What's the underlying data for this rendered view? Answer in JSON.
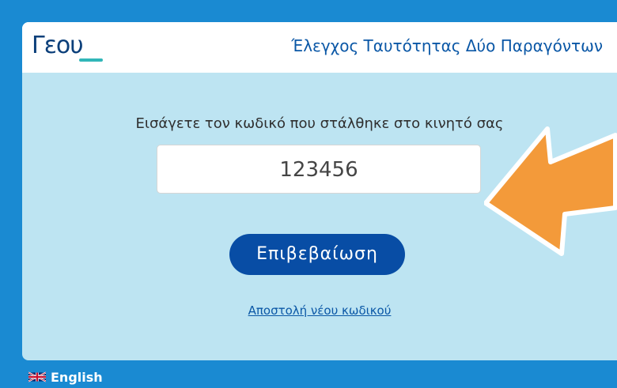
{
  "header": {
    "logo_text": "Γεου",
    "title": "Έλεγχος Ταυτότητας Δύο Παραγόντων"
  },
  "form": {
    "prompt": "Εισάγετε τον κωδικό που στάλθηκε στο κινητό σας",
    "code_value": "123456",
    "submit_label": "Επιβεβαίωση",
    "resend_label": "Αποστολή νέου κωδικού"
  },
  "footer": {
    "language_label": "English",
    "flag_icon": "uk-flag-icon"
  },
  "colors": {
    "background": "#1a8ad2",
    "card": "#bde4f2",
    "primary_button": "#084da5",
    "link": "#0a57a6",
    "annotation_arrow": "#f39a3a"
  }
}
